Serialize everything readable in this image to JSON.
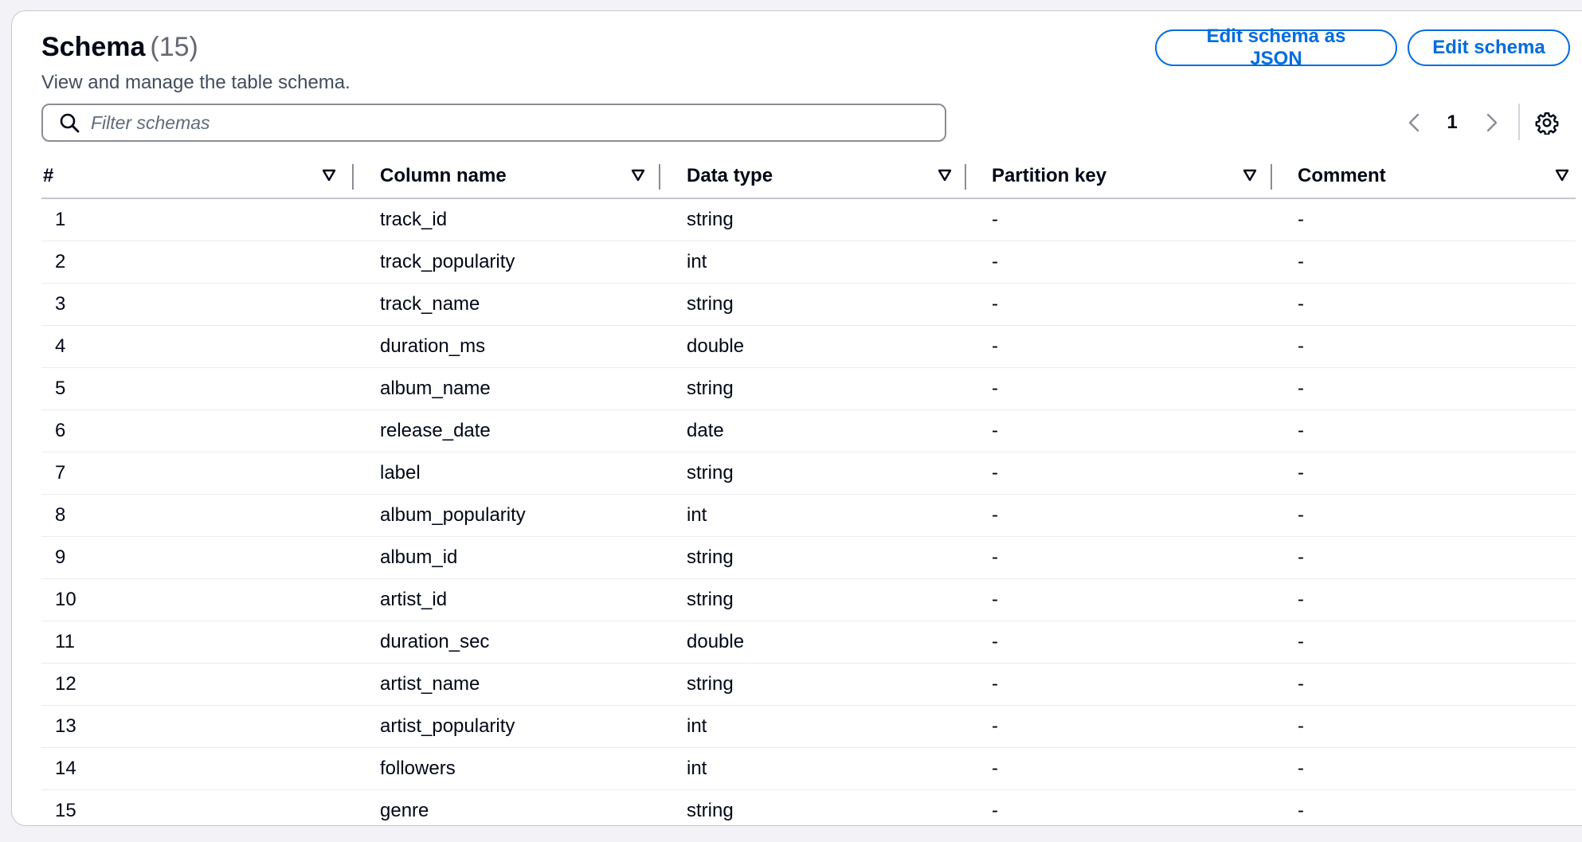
{
  "header": {
    "title": "Schema",
    "count": "(15)",
    "description": "View and manage the table schema.",
    "edit_json_label": "Edit schema as JSON",
    "edit_label": "Edit schema"
  },
  "search": {
    "placeholder": "Filter schemas",
    "value": ""
  },
  "pagination": {
    "current_page": "1"
  },
  "table": {
    "columns": [
      "#",
      "Column name",
      "Data type",
      "Partition key",
      "Comment"
    ],
    "rows": [
      {
        "num": "1",
        "name": "track_id",
        "type": "string",
        "partition_key": "-",
        "comment": "-"
      },
      {
        "num": "2",
        "name": "track_popularity",
        "type": "int",
        "partition_key": "-",
        "comment": "-"
      },
      {
        "num": "3",
        "name": "track_name",
        "type": "string",
        "partition_key": "-",
        "comment": "-"
      },
      {
        "num": "4",
        "name": "duration_ms",
        "type": "double",
        "partition_key": "-",
        "comment": "-"
      },
      {
        "num": "5",
        "name": "album_name",
        "type": "string",
        "partition_key": "-",
        "comment": "-"
      },
      {
        "num": "6",
        "name": "release_date",
        "type": "date",
        "partition_key": "-",
        "comment": "-"
      },
      {
        "num": "7",
        "name": "label",
        "type": "string",
        "partition_key": "-",
        "comment": "-"
      },
      {
        "num": "8",
        "name": "album_popularity",
        "type": "int",
        "partition_key": "-",
        "comment": "-"
      },
      {
        "num": "9",
        "name": "album_id",
        "type": "string",
        "partition_key": "-",
        "comment": "-"
      },
      {
        "num": "10",
        "name": "artist_id",
        "type": "string",
        "partition_key": "-",
        "comment": "-"
      },
      {
        "num": "11",
        "name": "duration_sec",
        "type": "double",
        "partition_key": "-",
        "comment": "-"
      },
      {
        "num": "12",
        "name": "artist_name",
        "type": "string",
        "partition_key": "-",
        "comment": "-"
      },
      {
        "num": "13",
        "name": "artist_popularity",
        "type": "int",
        "partition_key": "-",
        "comment": "-"
      },
      {
        "num": "14",
        "name": "followers",
        "type": "int",
        "partition_key": "-",
        "comment": "-"
      },
      {
        "num": "15",
        "name": "genre",
        "type": "string",
        "partition_key": "-",
        "comment": "-"
      }
    ]
  },
  "icons": {
    "search": "search-icon",
    "sort": "sort-caret-down-icon",
    "prev": "chevron-left-icon",
    "next": "chevron-right-icon",
    "settings": "gear-icon"
  },
  "colors": {
    "accent": "#006ce0",
    "text": "#000716",
    "muted": "#656871",
    "border": "#c6c6cd"
  }
}
